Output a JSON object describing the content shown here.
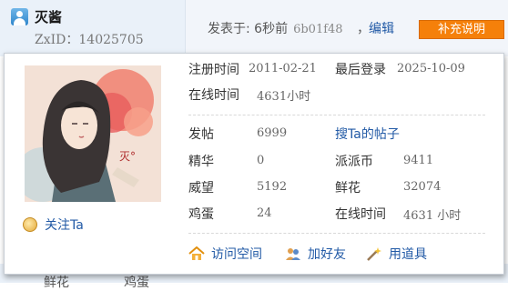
{
  "post": {
    "username": "灭酱",
    "zxid": "ZxID：14025705",
    "posted_label": "发表于: 6秒前",
    "hash": "6b01f48",
    "comma": "，",
    "edit_label": "编辑",
    "supplement_label": "补充说明"
  },
  "below": {
    "left_text": "鲜花",
    "right_text": "鸡蛋"
  },
  "card": {
    "follow_label": "关注Ta",
    "register_label": "注册时间",
    "register_value": "2011-02-21",
    "lastlogin_label": "最后登录",
    "lastlogin_value": "2025-10-09",
    "online_label": "在线时间",
    "online_value": "4631小时",
    "stats": {
      "posts_label": "发帖",
      "posts_value": "6999",
      "search_posts_label": "搜Ta的帖子",
      "digest_label": "精华",
      "digest_value": "0",
      "coins_label": "派派币",
      "coins_value": "9411",
      "prestige_label": "威望",
      "prestige_value": "5192",
      "flowers_label": "鲜花",
      "flowers_value": "32074",
      "eggs_label": "鸡蛋",
      "eggs_value": "24",
      "online2_label": "在线时间",
      "online2_value": "4631 小时"
    },
    "actions": {
      "visit_label": "访问空间",
      "addfriend_label": "加好友",
      "tool_label": "用道具"
    }
  },
  "colors": {
    "link": "#225aa6",
    "button_orange": "#f5800a",
    "header_bg": "#eaf1f9"
  },
  "icons": [
    "user-icon",
    "follow-icon",
    "home-icon",
    "friends-icon",
    "wand-icon"
  ]
}
